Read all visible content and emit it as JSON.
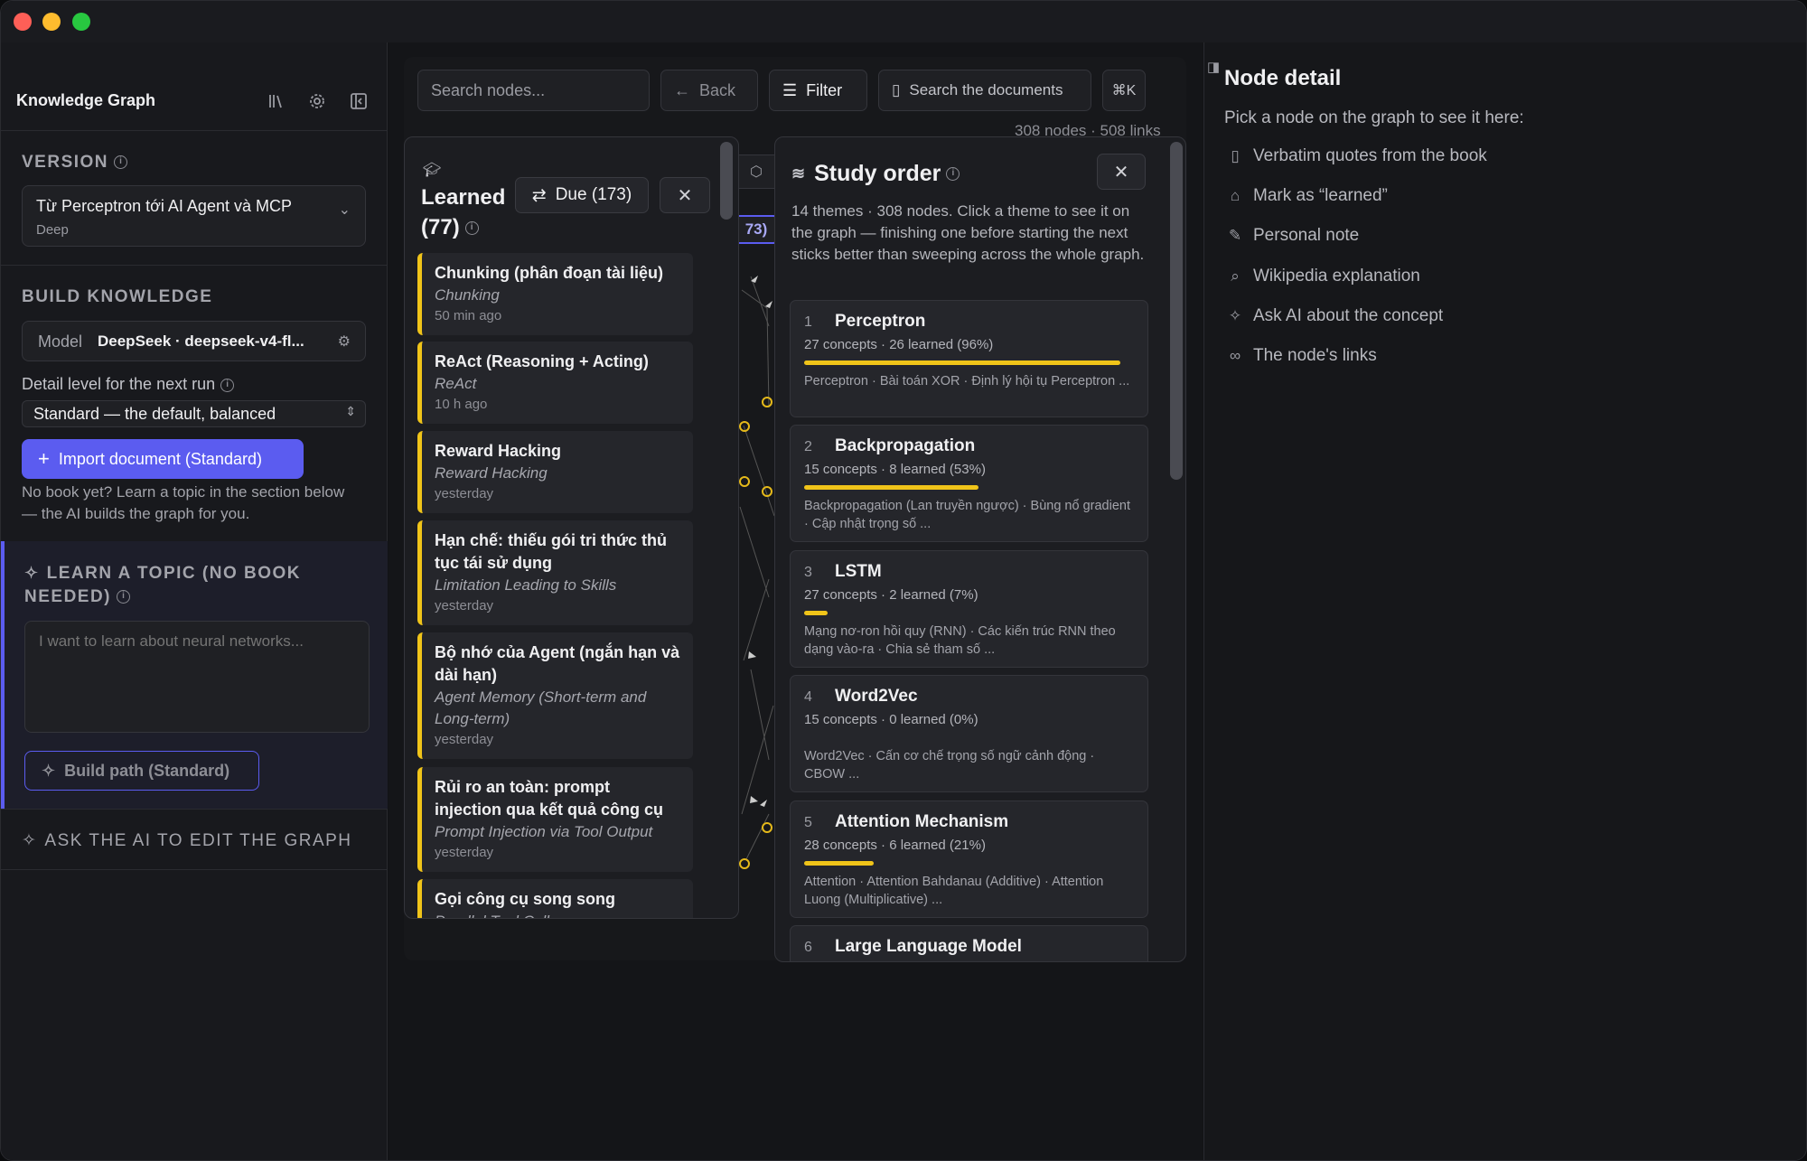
{
  "sidebar": {
    "title": "Knowledge Graph",
    "version": {
      "heading": "VERSION",
      "selected": "Từ Perceptron tới AI Agent và MCP",
      "mode": "Deep"
    },
    "build": {
      "heading": "BUILD KNOWLEDGE",
      "model_label": "Model",
      "model_value": "DeepSeek · deepseek-v4-fl...",
      "detail_label": "Detail level for the next run",
      "detail_value": "Standard — the default, balanced",
      "import_button": "Import document (Standard)",
      "hint": "No book yet? Learn a topic in the section below — the AI builds the graph for you."
    },
    "topic": {
      "heading": "LEARN A TOPIC (NO BOOK NEEDED)",
      "placeholder": "I want to learn about neural networks...",
      "build_button": "Build path (Standard)"
    },
    "ask_ai": "ASK THE AI TO EDIT THE GRAPH"
  },
  "toolbar": {
    "search_placeholder": "Search nodes...",
    "back": "Back",
    "filter": "Filter",
    "search_docs": "Search the documents",
    "shortcut": "⌘K",
    "stats": "308 nodes · 508 links"
  },
  "learned_panel": {
    "title": "Learned",
    "count": "(77)",
    "due_button": "Due (173)",
    "peek_badge": "73)",
    "items": [
      {
        "title": "Chunking (phân đoạn tài liệu)",
        "subtitle": "Chunking",
        "when": "50 min ago"
      },
      {
        "title": "ReAct (Reasoning + Acting)",
        "subtitle": "ReAct",
        "when": "10 h ago"
      },
      {
        "title": "Reward Hacking",
        "subtitle": "Reward Hacking",
        "when": "yesterday"
      },
      {
        "title": "Hạn chế: thiếu gói tri thức thủ tục tái sử dụng",
        "subtitle": "Limitation Leading to Skills",
        "when": "yesterday"
      },
      {
        "title": "Bộ nhớ của Agent (ngắn hạn và dài hạn)",
        "subtitle": "Agent Memory (Short-term and Long-term)",
        "when": "yesterday"
      },
      {
        "title": "Rủi ro an toàn: prompt injection qua kết quả công cụ",
        "subtitle": "Prompt Injection via Tool Output",
        "when": "yesterday"
      },
      {
        "title": "Gọi công cụ song song",
        "subtitle": "Parallel Tool Calls",
        "when": ""
      }
    ]
  },
  "study_panel": {
    "title": "Study order",
    "description": "14 themes · 308 nodes. Click a theme to see it on the graph — finishing one before starting the next sticks better than sweeping across the whole graph.",
    "themes": [
      {
        "n": "1",
        "name": "Perceptron",
        "counts": "27 concepts · 26 learned (96%)",
        "progress": 0.96,
        "sub": "Perceptron · Bài toán XOR · Định lý hội tụ Perceptron ..."
      },
      {
        "n": "2",
        "name": "Backpropagation",
        "counts": "15 concepts · 8 learned (53%)",
        "progress": 0.53,
        "sub": "Backpropagation (Lan truyền ngược) · Bùng nổ gradient · Cập nhật trọng số ..."
      },
      {
        "n": "3",
        "name": "LSTM",
        "counts": "27 concepts · 2 learned (7%)",
        "progress": 0.07,
        "sub": "Mạng nơ-ron hồi quy (RNN) · Các kiến trúc RNN theo dạng vào-ra · Chia sẻ tham số ..."
      },
      {
        "n": "4",
        "name": "Word2Vec",
        "counts": "15 concepts · 0 learned (0%)",
        "progress": 0,
        "sub": "Word2Vec · Cấn cơ chế trọng số ngữ cảnh động · CBOW ..."
      },
      {
        "n": "5",
        "name": "Attention Mechanism",
        "counts": "28 concepts · 6 learned (21%)",
        "progress": 0.21,
        "sub": "Attention · Attention Bahdanau (Additive) · Attention Luong (Multiplicative) ..."
      },
      {
        "n": "6",
        "name": "Large Language Model",
        "counts": "",
        "progress": 0,
        "sub": ""
      }
    ]
  },
  "detail": {
    "title": "Node detail",
    "intro": "Pick a node on the graph to see it here:",
    "items": [
      {
        "icon": "book-icon",
        "label": "Verbatim quotes from the book"
      },
      {
        "icon": "graduation-cap-icon",
        "label": "Mark as “learned”"
      },
      {
        "icon": "note-edit-icon",
        "label": "Personal note"
      },
      {
        "icon": "search-icon",
        "label": "Wikipedia explanation"
      },
      {
        "icon": "sparkles-icon",
        "label": "Ask AI about the concept"
      },
      {
        "icon": "link-icon",
        "label": "The node's links"
      }
    ]
  },
  "colors": {
    "accent": "#5b5cf0",
    "learned": "#f0c419",
    "bg": "#121316"
  }
}
